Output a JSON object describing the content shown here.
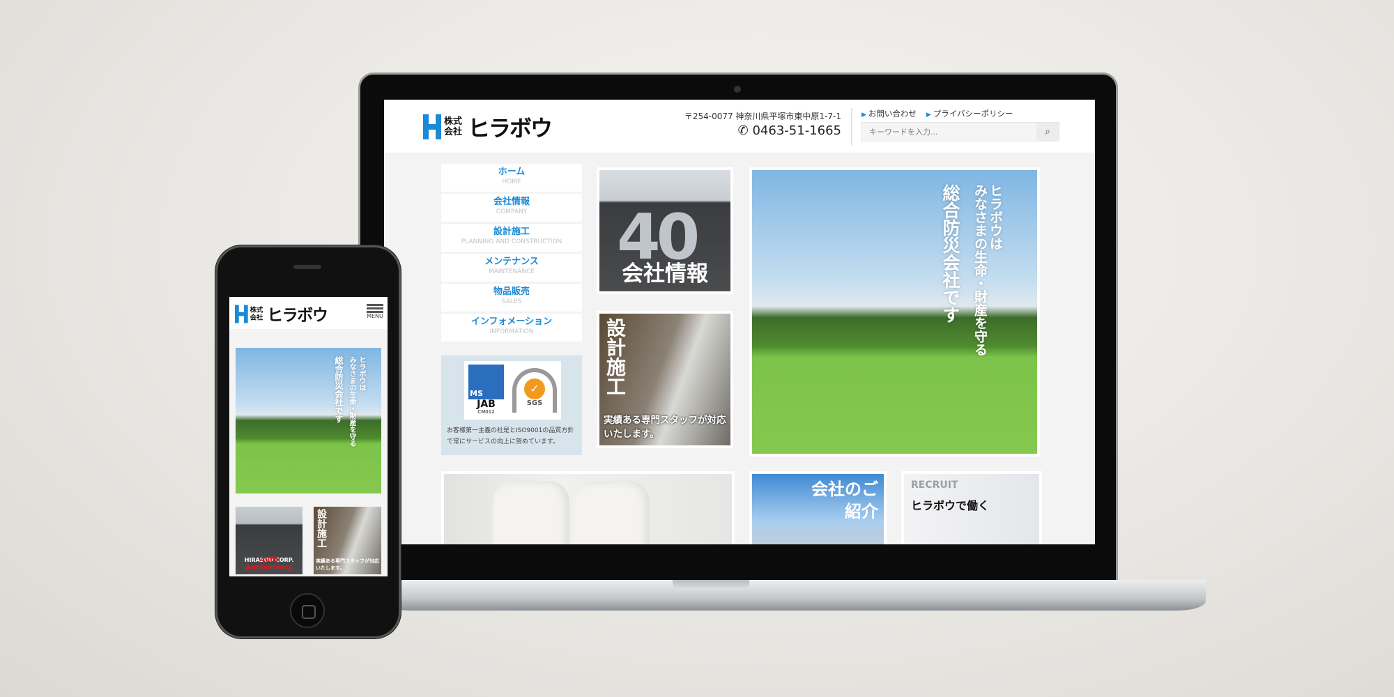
{
  "site": {
    "logo_small": "株式会社",
    "logo_big": "ヒラボウ"
  },
  "header": {
    "address": "〒254-0077 神奈川県平塚市東中原1-7-1",
    "phone": "0463-51-1665",
    "links": [
      "お問い合わせ",
      "プライバシーポリシー"
    ],
    "search_placeholder": "キーワードを入力..."
  },
  "nav": [
    {
      "jp": "ホーム",
      "en": "HOME"
    },
    {
      "jp": "会社情報",
      "en": "COMPANY"
    },
    {
      "jp": "設計施工",
      "en": "PLANNING AND CONSTRUCTION"
    },
    {
      "jp": "メンテナンス",
      "en": "MAINTENANCE"
    },
    {
      "jp": "物品販売",
      "en": "SALES"
    },
    {
      "jp": "インフォメーション",
      "en": "INFORMATION"
    }
  ],
  "cert": {
    "jab": "JAB",
    "ms": "MS",
    "jab_code": "CM012",
    "sgs": "SGS",
    "text": "お客様第一主義の社是とISO9001の品質方針で常にサービスの向上に努めています。"
  },
  "tiles": {
    "company": "会社情報",
    "forty": "40",
    "design_title": "設計施工",
    "design_caption": "実績ある専門スタッフが対応いたします。"
  },
  "hero": {
    "line1": "ヒラボウは",
    "line2": "みなさまの生命・財産を守る",
    "line3": "総合防災会社です"
  },
  "bottom": {
    "intro": "会社のご紹介",
    "recruit_en": "RECRUIT",
    "recruit_jp": "ヒラボウで働く"
  },
  "mobile": {
    "menu": "MENU",
    "anniv1": "HIRABOU CORP.",
    "anniv2": "40th Anniversary"
  },
  "colors": {
    "brand": "#1a8ad6",
    "anniversary": "#e6161c"
  }
}
